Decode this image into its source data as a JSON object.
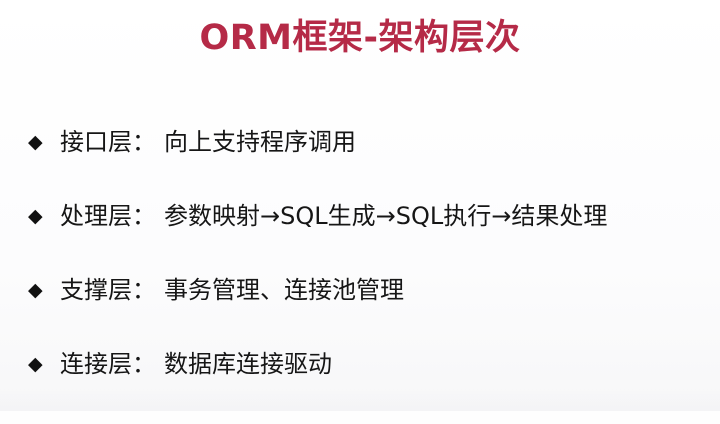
{
  "page": {
    "title": "ORM框架-架构层次",
    "accent_color": "#b52a47",
    "text_color": "#161616",
    "bullet_icon": "diamond-bullet-icon"
  },
  "items": [
    {
      "label": "接口层",
      "separator": "：",
      "description": "向上支持程序调用"
    },
    {
      "label": "处理层",
      "separator": "：",
      "description": "参数映射→SQL生成→SQL执行→结果处理"
    },
    {
      "label": "支撑层",
      "separator": "：",
      "description": "事务管理、连接池管理"
    },
    {
      "label": "连接层",
      "separator": "：",
      "description": "数据库连接驱动"
    }
  ]
}
